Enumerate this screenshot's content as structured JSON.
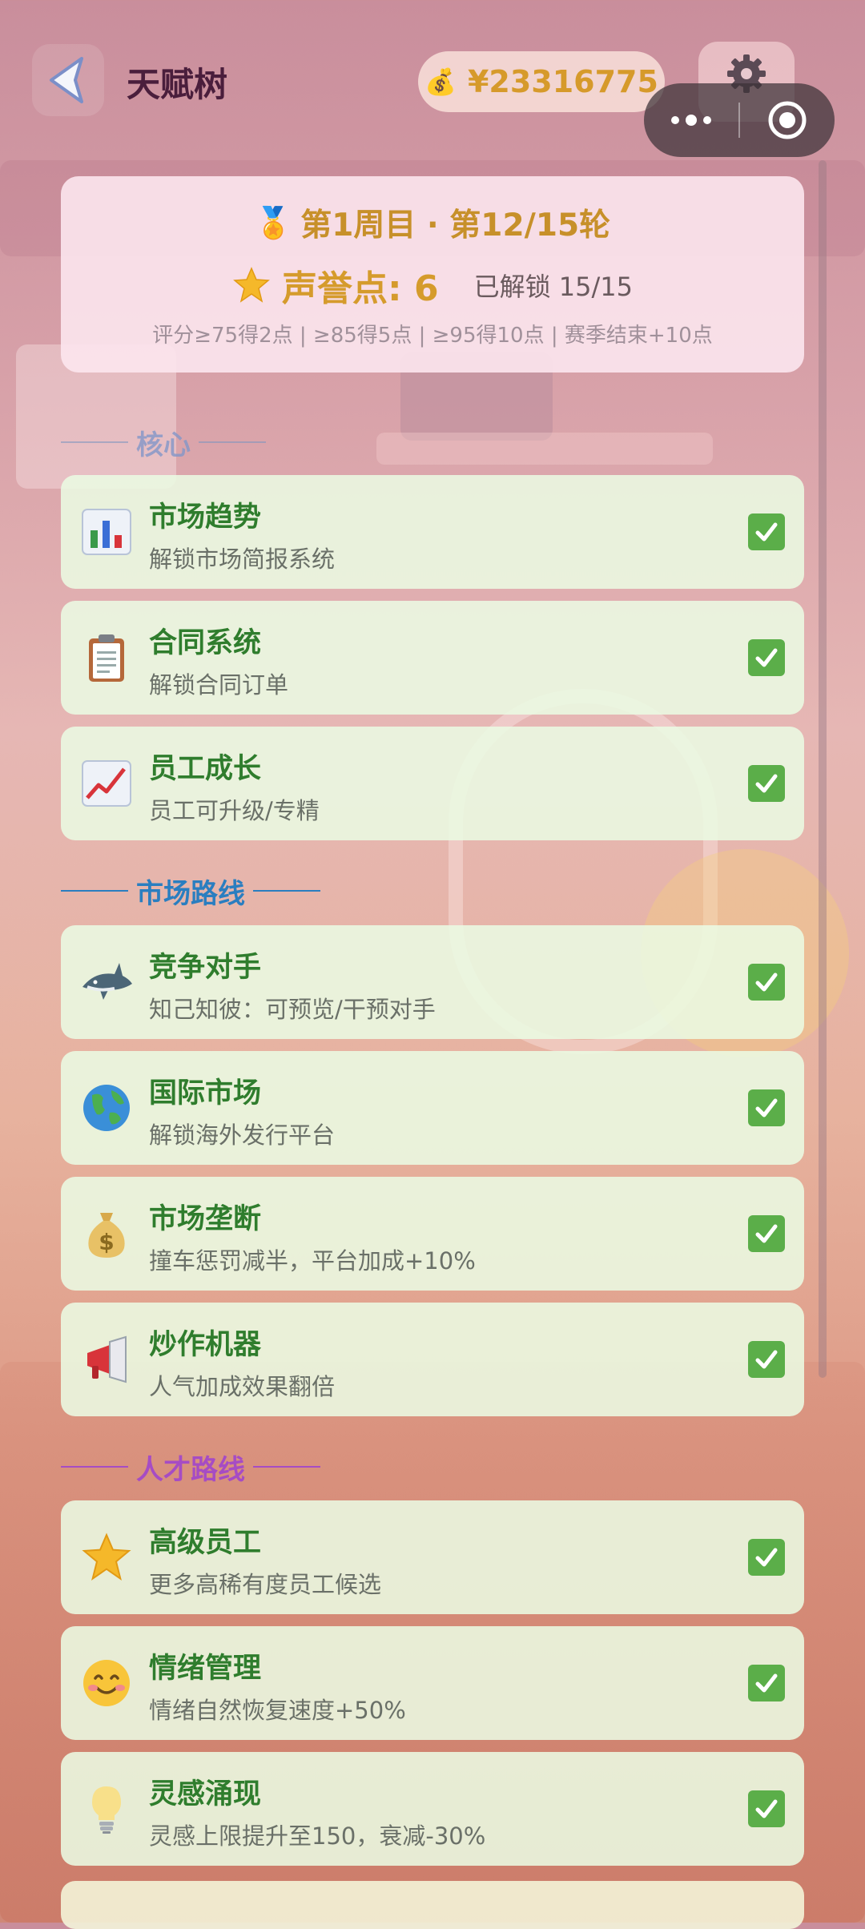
{
  "header": {
    "title": "天赋树",
    "money": "¥23316775"
  },
  "summary": {
    "cycle": "第1周目 · 第12/15轮",
    "reputation": "声誉点: 6",
    "unlocked": "已解锁 15/15",
    "rules": "评分≥75得2点 | ≥85得5点 | ≥95得10点 | 赛季结束+10点"
  },
  "sections": {
    "core": "核心",
    "market": "市场路线",
    "talent": "人才路线"
  },
  "talents": [
    {
      "icon": "bar-chart-icon",
      "name": "市场趋势",
      "desc": "解锁市场简报系统",
      "unlocked": true
    },
    {
      "icon": "clipboard-icon",
      "name": "合同系统",
      "desc": "解锁合同订单",
      "unlocked": true
    },
    {
      "icon": "growth-chart-icon",
      "name": "员工成长",
      "desc": "员工可升级/专精",
      "unlocked": true
    },
    {
      "icon": "shark-icon",
      "name": "竞争对手",
      "desc": "知己知彼：可预览/干预对手",
      "unlocked": true
    },
    {
      "icon": "globe-icon",
      "name": "国际市场",
      "desc": "解锁海外发行平台",
      "unlocked": true
    },
    {
      "icon": "money-bag-icon",
      "name": "市场垄断",
      "desc": "撞车惩罚减半，平台加成+10%",
      "unlocked": true
    },
    {
      "icon": "megaphone-icon",
      "name": "炒作机器",
      "desc": "人气加成效果翻倍",
      "unlocked": true
    },
    {
      "icon": "star-icon",
      "name": "高级员工",
      "desc": "更多高稀有度员工候选",
      "unlocked": true
    },
    {
      "icon": "smile-icon",
      "name": "情绪管理",
      "desc": "情绪自然恢复速度+50%",
      "unlocked": true
    },
    {
      "icon": "lightbulb-icon",
      "name": "灵感涌现",
      "desc": "灵感上限提升至150，衰减-30%",
      "unlocked": true
    }
  ],
  "colors": {
    "card_bg": "#eafae2",
    "name_green": "#2f7d2d",
    "check_green": "#5bae49",
    "gold": "#d59b2c",
    "market_blue": "#2a7ec0",
    "talent_purple": "#a64cc4"
  }
}
